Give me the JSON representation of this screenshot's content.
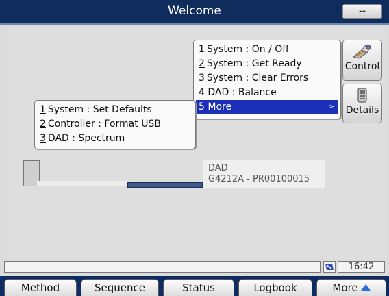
{
  "window": {
    "title": "Welcome",
    "corner_button": "--"
  },
  "main_menu": {
    "items": [
      {
        "num": "1",
        "label": "System : On / Off"
      },
      {
        "num": "2",
        "label": "System : Get Ready"
      },
      {
        "num": "3",
        "label": "System : Clear Errors"
      },
      {
        "num": "4",
        "label": "DAD : Balance"
      },
      {
        "num": "5",
        "label": "More",
        "selected": true,
        "arrow": ">"
      }
    ]
  },
  "sub_menu": {
    "items": [
      {
        "num": "1",
        "label": "System : Set Defaults"
      },
      {
        "num": "2",
        "label": "Controller : Format USB"
      },
      {
        "num": "3",
        "label": "DAD : Spectrum"
      }
    ]
  },
  "side_buttons": {
    "control": "Control",
    "details": "Details"
  },
  "module": {
    "name": "DAD",
    "id": "G4212A - PR00100015"
  },
  "status": {
    "message": "",
    "time": "16:42"
  },
  "tabs": {
    "method": "Method",
    "sequence": "Sequence",
    "status": "Status",
    "logbook": "Logbook",
    "more": "More"
  },
  "colors": {
    "title_bar": "#0f2c5c",
    "selection": "#1b2fb8",
    "tab_bar": "#0c2c63"
  }
}
